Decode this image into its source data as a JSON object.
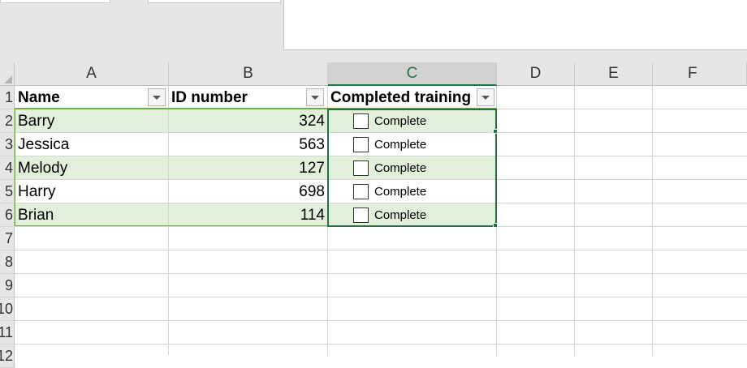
{
  "spreadsheet": {
    "columns": [
      "A",
      "B",
      "C",
      "D",
      "E",
      "F"
    ],
    "active_column": "C",
    "row_numbers": [
      "1",
      "2",
      "3",
      "4",
      "5",
      "6",
      "7",
      "8",
      "9",
      "10",
      "11",
      "12"
    ],
    "headers": {
      "name": "Name",
      "id": "ID number",
      "training": "Completed training"
    },
    "rows": [
      {
        "name": "Barry",
        "id": "324",
        "checkbox_label": "Complete",
        "checked": false
      },
      {
        "name": "Jessica",
        "id": "563",
        "checkbox_label": "Complete",
        "checked": false
      },
      {
        "name": "Melody",
        "id": "127",
        "checkbox_label": "Complete",
        "checked": false
      },
      {
        "name": "Harry",
        "id": "698",
        "checkbox_label": "Complete",
        "checked": false
      },
      {
        "name": "Brian",
        "id": "114",
        "checkbox_label": "Complete",
        "checked": false
      }
    ],
    "colors": {
      "accent": "#217346",
      "table_band": "#e2efda",
      "table_border": "#70ad47"
    }
  }
}
